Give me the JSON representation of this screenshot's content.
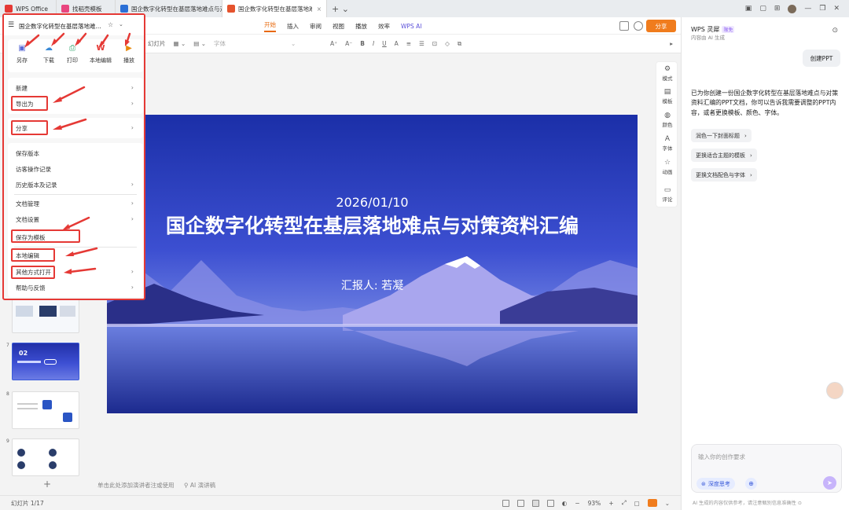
{
  "tabs": [
    {
      "label": "WPS Office",
      "icon": "wps-logo-icon",
      "color": "#e53935"
    },
    {
      "label": "找稻壳模板",
      "icon": "docer-icon",
      "color": "#e9467f"
    },
    {
      "label": "国企数字化转型在基层落地难点与对",
      "icon": "word-doc-icon",
      "color": "#2b6fd6"
    },
    {
      "label": "国企数字化转型在基层落地难点与",
      "icon": "ppt-doc-icon",
      "color": "#e5532d"
    }
  ],
  "ribbon": {
    "tabs": [
      "开始",
      "插入",
      "审阅",
      "视图",
      "播放",
      "效率",
      "WPS AI"
    ],
    "share_label": "分享",
    "toolbar_fragment": "幻灯片",
    "font_placeholder": "字体"
  },
  "file_menu": {
    "filename": "国企数字化转型在基层落地难...",
    "quick_actions": [
      {
        "label": "另存",
        "icon": "save-as-icon"
      },
      {
        "label": "下载",
        "icon": "download-icon"
      },
      {
        "label": "打印",
        "icon": "print-icon"
      },
      {
        "label": "本地编辑",
        "icon": "local-edit-icon"
      },
      {
        "label": "播放",
        "icon": "play-icon"
      }
    ],
    "group1": [
      "新建",
      "导出为"
    ],
    "group2": [
      "分享"
    ],
    "group3": [
      "保存版本",
      "访客操作记录",
      "历史版本及记录",
      "文档管理",
      "文档设置",
      "保存为模板",
      "本地编辑",
      "其他方式打开",
      "帮助与反馈"
    ]
  },
  "slide": {
    "date": "2026/01/10",
    "title": "国企数字化转型在基层落地难点与对策资料汇编",
    "reporter": "汇报人: 若凝"
  },
  "thumbnails": [
    {
      "num": "7",
      "label": "02"
    },
    {
      "num": "8",
      "label": ""
    },
    {
      "num": "9",
      "label": ""
    }
  ],
  "mini_tools": [
    {
      "label": "模式",
      "icon": "mode-icon"
    },
    {
      "label": "模板",
      "icon": "template-icon"
    },
    {
      "label": "颜色",
      "icon": "color-icon"
    },
    {
      "label": "字体",
      "icon": "font-icon"
    },
    {
      "label": "动画",
      "icon": "animation-icon"
    },
    {
      "label": "评论",
      "icon": "comment-icon"
    }
  ],
  "notes": {
    "placeholder": "单击此处添加演讲者注或使用",
    "ai_notes": "AI 演讲稿"
  },
  "status": {
    "slide_count": "幻灯片 1/17",
    "zoom": "93%"
  },
  "ai_panel": {
    "title": "WPS 灵犀",
    "badge": "限免",
    "subtitle": "内容由 AI 生成",
    "user_chip": "创建PPT",
    "message": "已为你创建一份国企数字化转型在基层落地难点与对策资料汇编的PPT文档，你可以告诉我需要调整的PPT内容，或者更换模板、颜色、字体。",
    "suggestions": [
      "润色一下封面标题",
      "更换适合主题的模板",
      "更换文档配色与字体"
    ],
    "input_placeholder": "输入你的创作要求",
    "deep_think": "深度思考",
    "footer": "AI 生成的内容仅供参考，请注意甄别信息准确性"
  },
  "colors": {
    "accent": "#e8690c",
    "highlight": "#e53935",
    "ai_purple": "#8a5cf0"
  }
}
